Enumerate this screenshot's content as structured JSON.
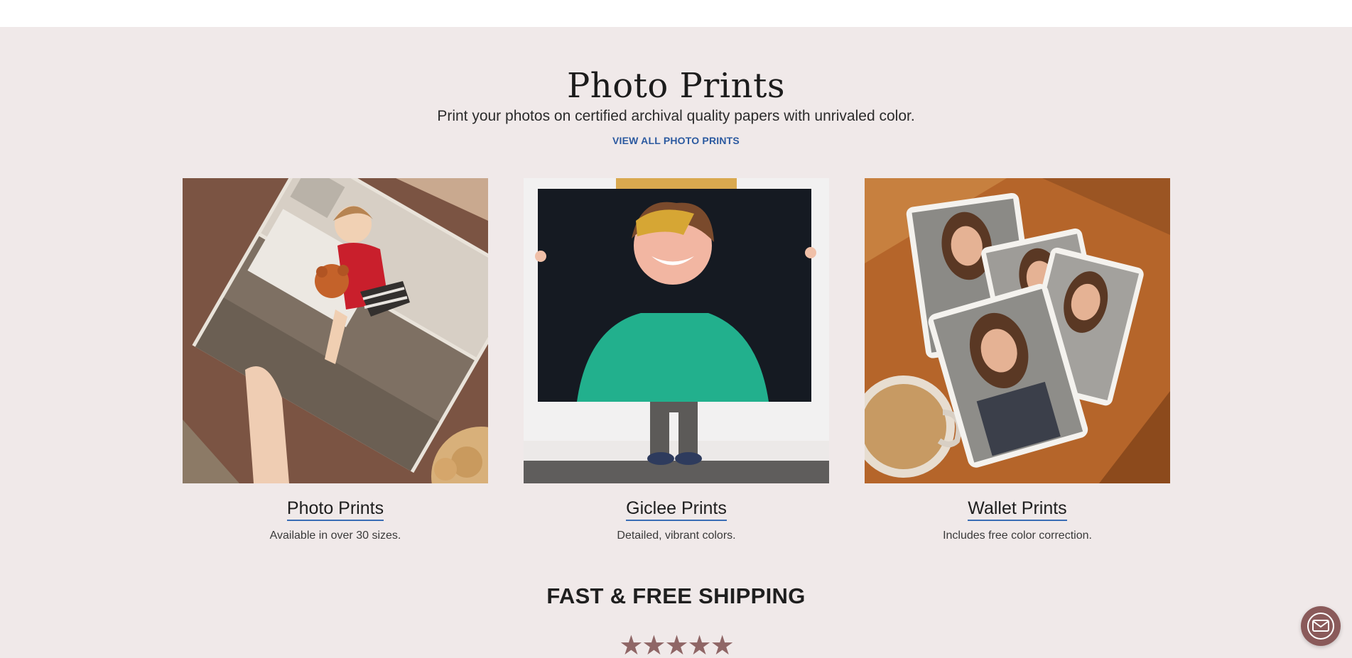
{
  "header": {
    "title": "Photo Prints",
    "subtitle": "Print your photos on certified archival quality papers with unrivaled color.",
    "view_all_label": "VIEW ALL PHOTO PRINTS"
  },
  "products": [
    {
      "name": "Photo Prints",
      "description": "Available in over 30 sizes.",
      "image": "toddler-on-couch-print-photo"
    },
    {
      "name": "Giclee Prints",
      "description": "Detailed, vibrant colors.",
      "image": "boy-holding-large-print-photo"
    },
    {
      "name": "Wallet Prints",
      "description": "Includes free color correction.",
      "image": "wallet-prints-on-table-photo"
    }
  ],
  "shipping": {
    "title": "FAST & FREE SHIPPING",
    "rating_stars": "★★★★★"
  },
  "chat": {
    "icon": "envelope-icon"
  },
  "colors": {
    "section_bg": "#f0e9e9",
    "link": "#2c5aa0",
    "underline": "#3a6db5",
    "star": "#8f6666",
    "chat_button": "#8a5a5a"
  }
}
